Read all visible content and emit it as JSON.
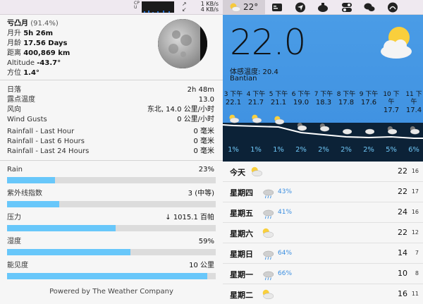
{
  "menubar": {
    "cpu_label": "CPU",
    "net_up": "1 KB/s",
    "net_down": "4 KB/s",
    "weather_temp": "22°",
    "weather_icon": "partly-cloudy-icon",
    "icons": [
      "window-icon",
      "navigation-arrow-icon",
      "cloud-app-icon",
      "toggle-icon",
      "wechat-icon",
      "app-icon"
    ]
  },
  "moon": {
    "phase": "亏凸月",
    "phase_pct": "(91.4%)",
    "rise_label": "月升",
    "rise": "5h 26m",
    "age_label": "月龄",
    "age": "17.56 Days",
    "distance_label": "距离",
    "distance": "400,869 km",
    "altitude_label": "Altitude",
    "altitude": "-43.7°",
    "azimuth_label": "方位",
    "azimuth": "1.4°"
  },
  "details": [
    {
      "label": "日落",
      "value": "2h 48m"
    },
    {
      "label": "露点温度",
      "value": "13.0"
    },
    {
      "label": "风向",
      "value": "东北, 14.0 公里/小时"
    },
    {
      "label": "Wind Gusts",
      "value": "0 公里/小时"
    }
  ],
  "rainfall": [
    {
      "label": "Rainfall - Last Hour",
      "value": "0 毫米"
    },
    {
      "label": "Rainfall - Last 6 Hours",
      "value": "0 毫米"
    },
    {
      "label": "Rainfall - Last 24 Hours",
      "value": "0 毫米"
    }
  ],
  "bars": [
    {
      "label": "Rain",
      "value": "23%",
      "fill": 0.23
    },
    {
      "label": "紫外线指数",
      "value": "3 (中等)",
      "fill": 0.25
    },
    {
      "label": "压力",
      "value": "↓ 1015.1 百帕",
      "fill": 0.52
    },
    {
      "label": "湿度",
      "value": "59%",
      "fill": 0.59
    },
    {
      "label": "能见度",
      "value": "10 公里",
      "fill": 0.96
    }
  ],
  "powered_by": "Powered by The Weather Company",
  "current": {
    "temp": "22.0",
    "feels_like": "体感温度: 20.4",
    "location": "Bantian"
  },
  "hourly": [
    {
      "time": "3 下午",
      "temp": "22.1",
      "icon": "sun-cloud-icon",
      "precip": "1%"
    },
    {
      "time": "4 下午",
      "temp": "21.7",
      "icon": "sun-cloud-icon",
      "precip": "1%"
    },
    {
      "time": "5 下午",
      "temp": "21.1",
      "icon": "sun-cloud-icon",
      "precip": "1%"
    },
    {
      "time": "6 下午",
      "temp": "19.0",
      "icon": "moon-cloud-icon",
      "precip": "2%"
    },
    {
      "time": "7 下午",
      "temp": "18.3",
      "icon": "moon-cloud-icon",
      "precip": "2%"
    },
    {
      "time": "8 下午",
      "temp": "17.8",
      "icon": "cloud-icon",
      "precip": "2%"
    },
    {
      "time": "9 下午",
      "temp": "17.6",
      "icon": "cloud-icon",
      "precip": "2%"
    },
    {
      "time": "10 下午",
      "temp": "17.7",
      "icon": "moon-cloud-icon",
      "precip": "5%"
    },
    {
      "time": "11 下午",
      "temp": "17.4",
      "icon": "moon-cloud-icon",
      "precip": "6%"
    }
  ],
  "daily": [
    {
      "name": "今天",
      "icon": "sun-cloud-icon",
      "precip": "",
      "hi": "22",
      "lo": "16"
    },
    {
      "name": "星期四",
      "icon": "cloud-rain-icon",
      "precip": "43%",
      "hi": "22",
      "lo": "17"
    },
    {
      "name": "星期五",
      "icon": "cloud-rain-icon",
      "precip": "41%",
      "hi": "24",
      "lo": "16"
    },
    {
      "name": "星期六",
      "icon": "sun-cloud-icon",
      "precip": "",
      "hi": "22",
      "lo": "12"
    },
    {
      "name": "星期日",
      "icon": "cloud-rain-icon",
      "precip": "64%",
      "hi": "14",
      "lo": "7"
    },
    {
      "name": "星期一",
      "icon": "cloud-rain-icon",
      "precip": "66%",
      "hi": "10",
      "lo": "8"
    },
    {
      "name": "星期二",
      "icon": "sun-cloud-icon",
      "precip": "",
      "hi": "16",
      "lo": "11"
    }
  ],
  "colors": {
    "accent": "#68c7fa",
    "sky": "#4a9ce6",
    "dark": "#0c2237",
    "precip": "#3a8ee0"
  }
}
